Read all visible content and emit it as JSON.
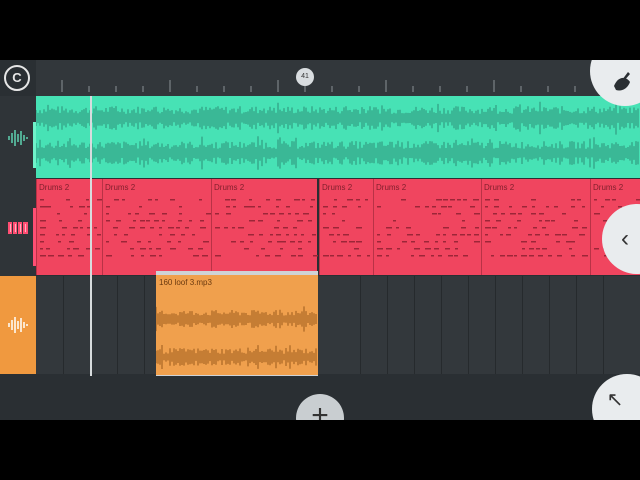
{
  "app": {
    "logo_glyph": "C",
    "fruit_icon": "fl-fruit-icon"
  },
  "ruler": {
    "marker_label": "41"
  },
  "tracks": [
    {
      "type": "audio",
      "icon": "waveform-icon",
      "color": "#47e2b5"
    },
    {
      "type": "pattern",
      "icon": "piano-roll-icon",
      "color": "#f0455f",
      "clips": [
        {
          "label": "Drums 2"
        },
        {
          "label": "Drums 2"
        },
        {
          "label": "Drums 2"
        },
        {
          "label": "Drums 2"
        },
        {
          "label": "Drums 2"
        },
        {
          "label": "Drums 2"
        },
        {
          "label": "Drums 2"
        }
      ]
    },
    {
      "type": "audio",
      "icon": "waveform-icon",
      "color": "#f0993f",
      "clip": {
        "label": "160 loof 3.mp3"
      }
    }
  ],
  "buttons": {
    "add": "+",
    "collapse": "‹",
    "expand": "↖"
  }
}
